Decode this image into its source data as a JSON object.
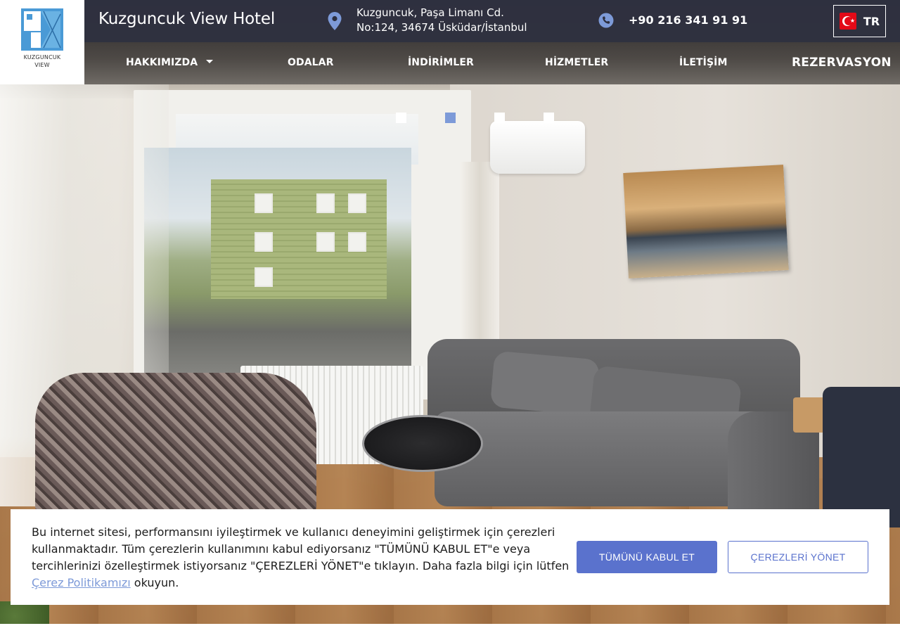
{
  "logo": {
    "text_line1": "KUZGUNCUK",
    "text_line2": "VIEW",
    "icon": "building-logo-icon"
  },
  "header": {
    "brand": "Kuzguncuk View Hotel",
    "address_line1": "Kuzguncuk, Paşa Limanı Cd.",
    "address_line2": "No:124, 34674 Üsküdar/İstanbul",
    "address_icon": "map-pin-icon",
    "phone": "+90 216 341 91 91",
    "phone_icon": "phone-icon",
    "language": {
      "code": "TR",
      "flag_icon": "turkey-flag-icon"
    }
  },
  "nav": {
    "items": [
      {
        "label": "HAKKIMIZDA",
        "has_dropdown": true
      },
      {
        "label": "ODALAR"
      },
      {
        "label": "İNDİRİMLER"
      },
      {
        "label": "HİZMETLER"
      },
      {
        "label": "İLETİŞİM"
      }
    ],
    "cta": "REZERVASYON"
  },
  "carousel": {
    "slide_count": 4,
    "active_index": 1,
    "active_color": "#7d9ad8",
    "inactive_color": "#ffffff"
  },
  "cookie_banner": {
    "text_before_link": "Bu internet sitesi, performansını iyileştirmek ve kullanıcı deneyimini geliştirmek için çerezleri kullanmaktadır. Tüm çerezlerin kullanımını kabul ediyorsanız \"TÜMÜNÜ KABUL ET\"e veya tercihlerinizi özelleştirmek istiyorsanız \"ÇEREZLERİ YÖNET\"e tıklayın. Daha fazla bilgi için lütfen ",
    "link_text": "Çerez Politikamızı",
    "text_after_link": " okuyun.",
    "accept_label": "TÜMÜNÜ KABUL ET",
    "manage_label": "ÇEREZLERİ YÖNET"
  },
  "colors": {
    "topbar": "#2c2e3e",
    "accent": "#5a72cd",
    "link": "#7d9ad8",
    "icon_accent": "#7d9ad8"
  }
}
